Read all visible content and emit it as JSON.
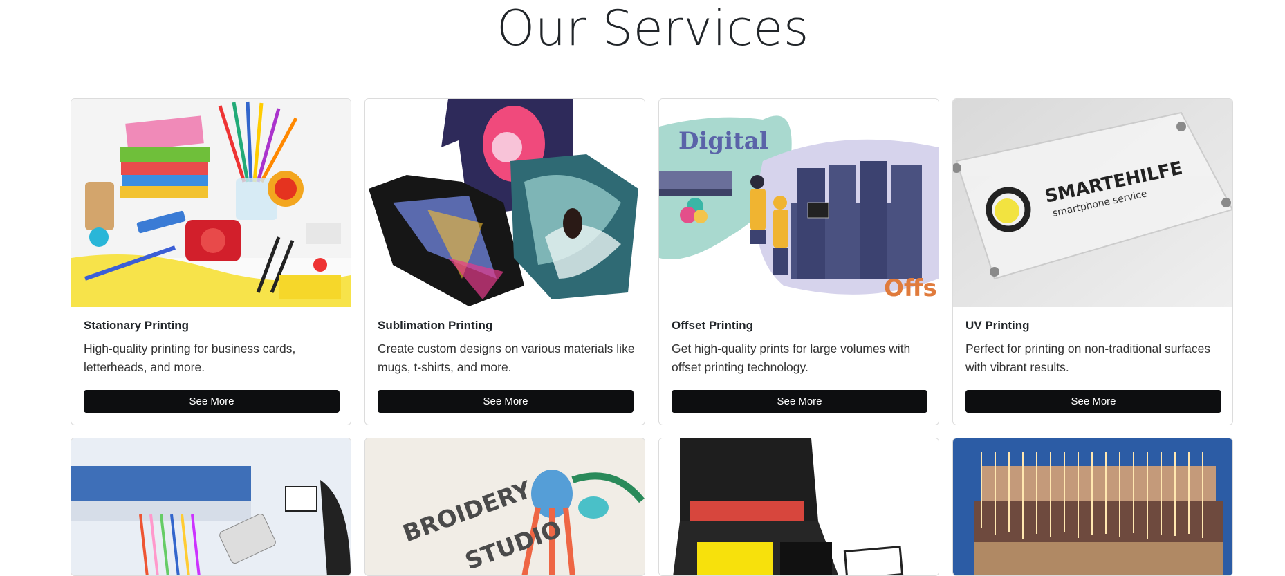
{
  "section_title": "Our Services",
  "services": [
    {
      "title": "Stationary Printing",
      "description": "High-quality printing for business cards, letterheads, and more.",
      "button": "See More"
    },
    {
      "title": "Sublimation Printing",
      "description": "Create custom designs on various materials like mugs, t-shirts, and more.",
      "button": "See More"
    },
    {
      "title": "Offset Printing",
      "description": "Get high-quality prints for large volumes with offset printing technology.",
      "button": "See More"
    },
    {
      "title": "UV Printing",
      "description": "Perfect for printing on non-traditional surfaces with vibrant results.",
      "button": "See More"
    }
  ],
  "image_text": {
    "digital": "Digital",
    "offs": "Offs",
    "brand": "SMARTEHILFE",
    "brand_sub": "smartphone service",
    "embroidery": "BROIDERY",
    "studio": "STUDIO"
  },
  "colors": {
    "button_bg": "#0d0e10",
    "button_text": "#ffffff",
    "digital_text": "#5a63a8",
    "offs_text": "#e07b3c"
  }
}
